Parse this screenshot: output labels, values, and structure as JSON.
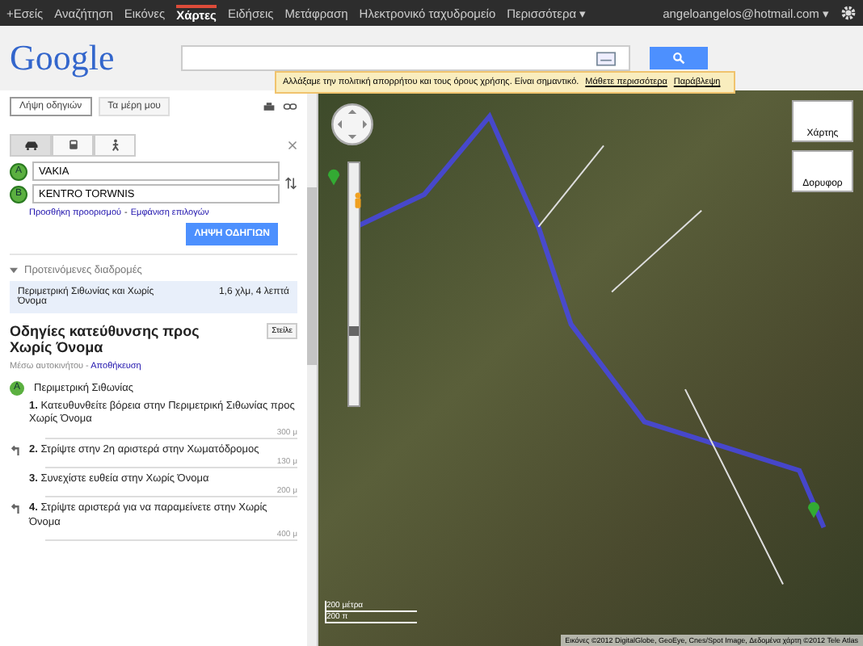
{
  "topbar": {
    "items": [
      {
        "label": "+Εσείς",
        "selected": false
      },
      {
        "label": "Αναζήτηση",
        "selected": false
      },
      {
        "label": "Εικόνες",
        "selected": false
      },
      {
        "label": "Χάρτες",
        "selected": true
      },
      {
        "label": "Ειδήσεις",
        "selected": false
      },
      {
        "label": "Μετάφραση",
        "selected": false
      },
      {
        "label": "Ηλεκτρονικό ταχυδρομείο",
        "selected": false
      },
      {
        "label": "Περισσότερα ▾",
        "selected": false
      }
    ],
    "account": "angeloangelos@hotmail.com ▾"
  },
  "logo": "Google",
  "notice": {
    "text": "Αλλάξαμε την πολιτική απορρήτου και τους όρους χρήσης. Είναι σημαντικό.",
    "links": [
      "Μάθετε περισσότερα",
      "Παράβλεψη"
    ]
  },
  "sidebar": {
    "tabs": [
      {
        "label": "Λήψη οδηγιών",
        "selected": true
      },
      {
        "label": "Τα μέρη μου",
        "selected": false
      }
    ],
    "modes": [
      {
        "kind": "car",
        "selected": true
      },
      {
        "kind": "bus",
        "selected": false
      },
      {
        "kind": "walk",
        "selected": false
      }
    ],
    "waypoints": [
      {
        "marker": "A",
        "value": "VAKIA"
      },
      {
        "marker": "B",
        "value": "KENTRO TORWNIS"
      }
    ],
    "options_links": [
      "Προσθήκη προορισμού",
      "Εμφάνιση επιλογών"
    ],
    "options_separator": "-",
    "go_button": "ΛΗΨΗ ΟΔΗΓΙΩΝ",
    "routes_heading": "Προτεινόμενες διαδρομές",
    "routes": [
      {
        "name": "Περιμετρική Σιθωνίας και Χωρίς Όνομα",
        "summary": "1,6 χλμ, 4 λεπτά",
        "selected": true
      }
    ],
    "directions_title": "Οδηγίες κατεύθυνσης προς Χωρίς Όνομα",
    "send_button": "Στείλε",
    "directions_sub": "Μέσω αυτοκινήτου -",
    "directions_link": "Αποθήκευση",
    "start": {
      "marker": "A",
      "label": "Περιμετρική Σιθωνίας"
    },
    "steps": [
      {
        "num": "1.",
        "text": "Κατευθυνθείτε βόρεια στην Περιμετρική Σιθωνίας προς Χωρίς Όνομα",
        "distance": "300 μ",
        "kind": "straight"
      },
      {
        "num": "2.",
        "text": "Στρίψτε στην 2η αριστερά στην Χωματόδρομος",
        "distance": "130 μ",
        "kind": "left"
      },
      {
        "num": "3.",
        "text": "Συνεχίστε ευθεία στην Χωρίς Όνομα",
        "distance": "200 μ",
        "kind": "straight"
      },
      {
        "num": "4.",
        "text": "Στρίψτε αριστερά για να παραμείνετε στην Χωρίς Όνομα",
        "distance": "400 μ",
        "kind": "left"
      }
    ]
  },
  "map": {
    "zoom": {
      "level": 0.3
    },
    "types": [
      "Χάρτης",
      "Δορυφορ"
    ],
    "scale": [
      "200 μέτρα",
      "200 π"
    ],
    "copyright": "Εικόνες ©2012 DigitalGlobe, GeoEye, Cnes/Spot Image, Δεδομένα χάρτη ©2012 Tele Atlas"
  }
}
